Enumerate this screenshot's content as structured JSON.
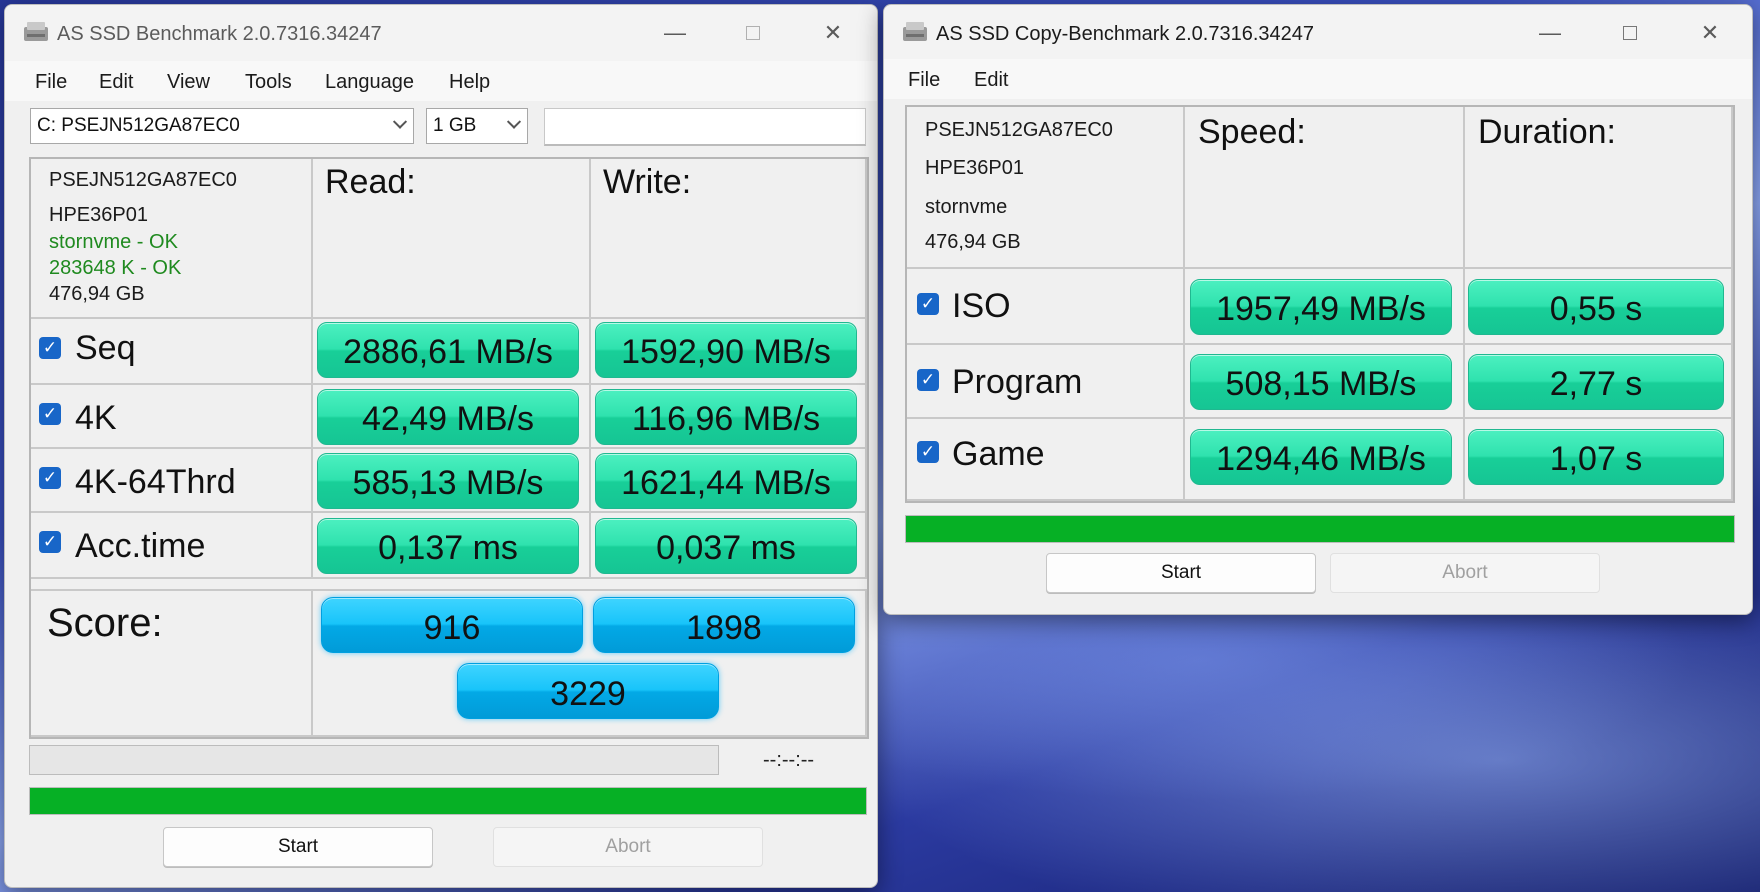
{
  "main_window": {
    "title": "AS SSD Benchmark 2.0.7316.34247",
    "menu": [
      "File",
      "Edit",
      "View",
      "Tools",
      "Language",
      "Help"
    ],
    "drive_select": "C: PSEJN512GA87EC0",
    "size_select": "1 GB",
    "textbox_value": "",
    "drive_info": [
      "PSEJN512GA87EC0",
      "HPE36P01",
      "stornvme - OK",
      "283648 K - OK",
      "476,94 GB"
    ],
    "col_read": "Read:",
    "col_write": "Write:",
    "rows": [
      {
        "label": "Seq",
        "checked": true,
        "read": "2886,61 MB/s",
        "write": "1592,90 MB/s"
      },
      {
        "label": "4K",
        "checked": true,
        "read": "42,49 MB/s",
        "write": "116,96 MB/s"
      },
      {
        "label": "4K-64Thrd",
        "checked": true,
        "read": "585,13 MB/s",
        "write": "1621,44 MB/s"
      },
      {
        "label": "Acc.time",
        "checked": true,
        "read": "0,137 ms",
        "write": "0,037 ms"
      }
    ],
    "score_label": "Score:",
    "score_read": "916",
    "score_write": "1898",
    "score_total": "3229",
    "time_label": "--:--:--",
    "progress_percent": 100,
    "start_label": "Start",
    "abort_label": "Abort"
  },
  "copy_window": {
    "title": "AS SSD Copy-Benchmark 2.0.7316.34247",
    "menu": [
      "File",
      "Edit"
    ],
    "drive_info": [
      "PSEJN512GA87EC0",
      "HPE36P01",
      "stornvme",
      "476,94 GB"
    ],
    "col_speed": "Speed:",
    "col_duration": "Duration:",
    "rows": [
      {
        "label": "ISO",
        "checked": true,
        "speed": "1957,49 MB/s",
        "duration": "0,55 s"
      },
      {
        "label": "Program",
        "checked": true,
        "speed": "508,15 MB/s",
        "duration": "2,77 s"
      },
      {
        "label": "Game",
        "checked": true,
        "speed": "1294,46 MB/s",
        "duration": "1,07 s"
      }
    ],
    "progress_percent": 100,
    "start_label": "Start",
    "abort_label": "Abort"
  },
  "colors": {
    "value_green": "#2fe2ae",
    "score_blue": "#18c4fa",
    "progress_green": "#06b025",
    "ok_text": "#1f8a1f"
  },
  "icons": {
    "app_icon": "drive-icon",
    "checkbox": "checkmark-icon",
    "minimize": "minimize-icon",
    "maximize": "maximize-icon",
    "close": "close-icon"
  }
}
